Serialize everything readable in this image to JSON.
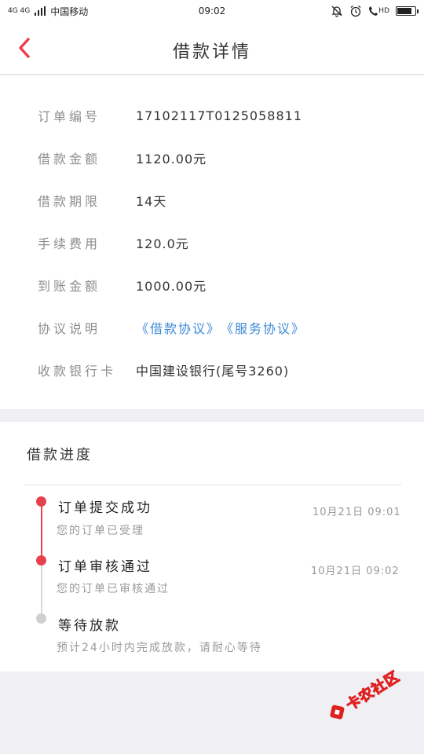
{
  "status_bar": {
    "network": "4G 4G",
    "carrier": "中国移动",
    "time": "09:02",
    "hd": "HD",
    "battery_level": 0.85
  },
  "header": {
    "title": "借款详情"
  },
  "details": {
    "order_no": {
      "label": "订单编号",
      "value": "17102117T0125058811"
    },
    "loan_amount": {
      "label": "借款金额",
      "value": "1120.00元"
    },
    "loan_term": {
      "label": "借款期限",
      "value": "14天"
    },
    "fee": {
      "label": "手续费用",
      "value": "120.0元"
    },
    "arrival_amount": {
      "label": "到账金额",
      "value": "1000.00元"
    },
    "agreement": {
      "label": "协议说明",
      "link1": "《借款协议》",
      "link2": "《服务协议》"
    },
    "bank_card": {
      "label": "收款银行卡",
      "value": "中国建设银行(尾号3260)"
    }
  },
  "progress": {
    "title": "借款进度",
    "steps": [
      {
        "title": "订单提交成功",
        "desc": "您的订单已受理",
        "time": "10月21日 09:01"
      },
      {
        "title": "订单审核通过",
        "desc": "您的订单已审核通过",
        "time": "10月21日 09:02"
      },
      {
        "title": "等待放款",
        "desc": "预计24小时内完成放款，请耐心等待"
      }
    ]
  },
  "watermark": {
    "text": "卡农社区"
  },
  "colors": {
    "accent": "#e8404d",
    "link": "#3d8ad8",
    "pending": "#cfcfcf"
  }
}
